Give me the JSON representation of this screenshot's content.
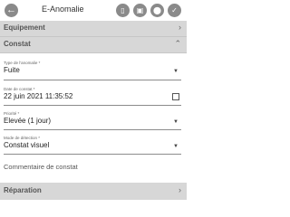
{
  "header": {
    "title": "E-Anomalie",
    "back_icon": "arrow-left-icon",
    "actions": [
      "attachment-icon",
      "camera-icon",
      "location-pin-icon",
      "check-icon"
    ]
  },
  "sections": {
    "equipement": "Equipement",
    "constat": "Constat",
    "reparation": "Réparation"
  },
  "fields": {
    "type": {
      "label": "Type de l'anomalie *",
      "value": "Fuite"
    },
    "date": {
      "label": "Date de constat *",
      "value": "22 juin 2021 11:35:52"
    },
    "priorite": {
      "label": "Priorité *",
      "value": "Elevée (1 jour)"
    },
    "mode": {
      "label": "Mode de détection *",
      "value": "Constat visuel"
    }
  },
  "comment": {
    "placeholder": "Commentaire de constat"
  }
}
